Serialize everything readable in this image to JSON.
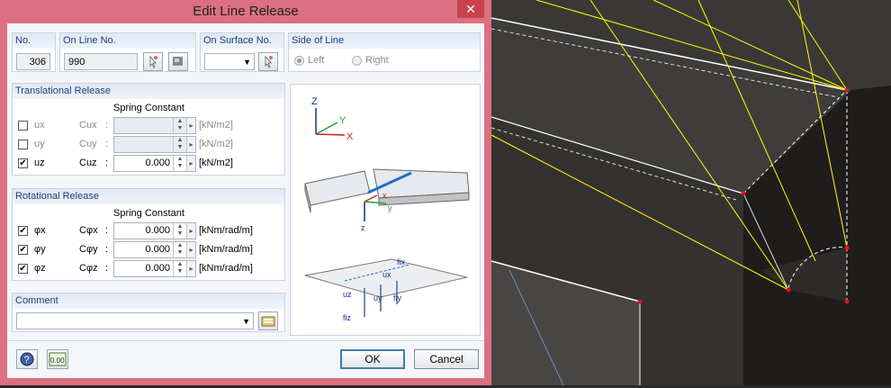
{
  "dialog": {
    "title": "Edit Line Release",
    "close_glyph": "✕",
    "no": {
      "label": "No.",
      "value": "306"
    },
    "on_line_no": {
      "label": "On Line No.",
      "value": "990"
    },
    "on_surface_no": {
      "label": "On Surface No.",
      "value": ""
    },
    "side_of_line": {
      "label": "Side of Line",
      "left": "Left",
      "right": "Right",
      "selected": "Left"
    },
    "translational": {
      "title": "Translational Release",
      "spring_constant": "Spring Constant",
      "rows": [
        {
          "dof": "ux",
          "const": "Cux",
          "colon": ":",
          "value": "",
          "unit": "[kN/m2]",
          "checked": false
        },
        {
          "dof": "uy",
          "const": "Cuy",
          "colon": ":",
          "value": "",
          "unit": "[kN/m2]",
          "checked": false
        },
        {
          "dof": "uz",
          "const": "Cuz",
          "colon": ":",
          "value": "0.000",
          "unit": "[kN/m2]",
          "checked": true
        }
      ]
    },
    "rotational": {
      "title": "Rotational Release",
      "spring_constant": "Spring Constant",
      "rows": [
        {
          "dof": "φx",
          "const": "Cφx",
          "colon": ":",
          "value": "0.000",
          "unit": "[kNm/rad/m]",
          "checked": true
        },
        {
          "dof": "φy",
          "const": "Cφy",
          "colon": ":",
          "value": "0.000",
          "unit": "[kNm/rad/m]",
          "checked": true
        },
        {
          "dof": "φz",
          "const": "Cφz",
          "colon": ":",
          "value": "0.000",
          "unit": "[kNm/rad/m]",
          "checked": true
        }
      ]
    },
    "comment": {
      "label": "Comment",
      "value": ""
    },
    "ok": "OK",
    "cancel": "Cancel",
    "units_button_text": "0.00",
    "graphic": {
      "axis_z": "Z",
      "axis_y": "Y",
      "axis_x": "X",
      "plate_x": "x",
      "plate_y": "y",
      "plate_z": "z",
      "f_ix": "fix",
      "u_x": "ux",
      "u_z": "uz",
      "u_y": "uy",
      "f_iy": "fiy",
      "f_iz": "fiz"
    }
  },
  "colors": {
    "title_bar": "#dc7080",
    "close_button": "#c8434f",
    "group_header": "#1b3f7a",
    "accent_blue": "#1f6fc7",
    "ok_border": "#3c7fb1",
    "viewport_bg": "#2a2826",
    "member_line": "#ffff00",
    "node": "#e01020"
  }
}
